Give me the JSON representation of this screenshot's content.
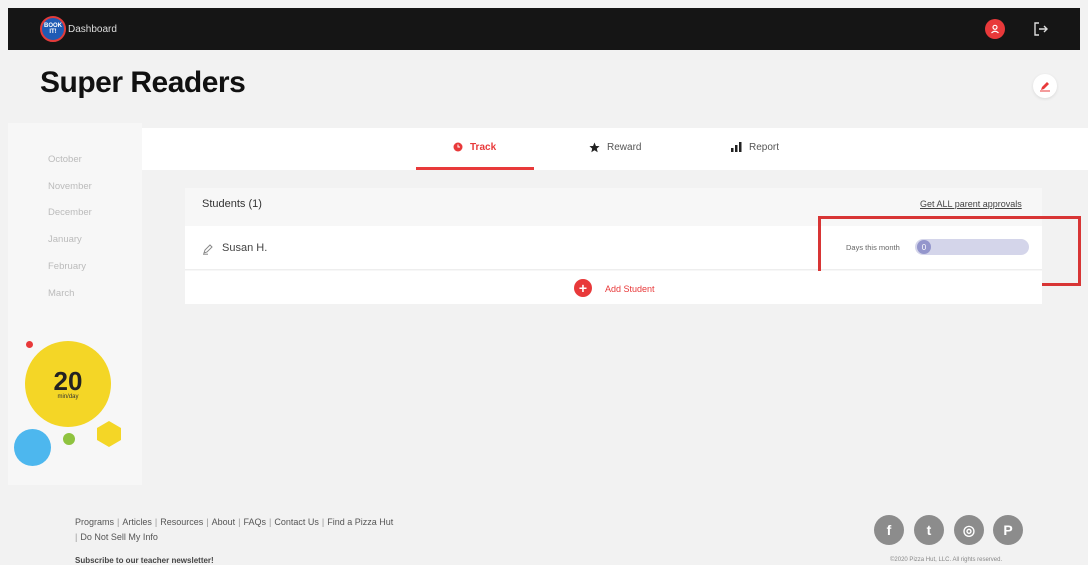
{
  "app": {
    "logo_text": [
      "BOOK",
      "IT!"
    ],
    "nav_label": "Dashboard"
  },
  "page": {
    "title": "Super Readers"
  },
  "sidebar": {
    "months": [
      "October",
      "November",
      "December",
      "January",
      "February",
      "March"
    ]
  },
  "tabs": [
    {
      "label": "Track",
      "icon": "clock-icon",
      "active": true
    },
    {
      "label": "Reward",
      "icon": "star-icon",
      "active": false
    },
    {
      "label": "Report",
      "icon": "bar-chart-icon",
      "active": false
    }
  ],
  "students": {
    "heading": "Students (1)",
    "approvals_link": "Get ALL parent approvals",
    "rows": [
      {
        "name": "Susan H.",
        "days_label": "Days this month",
        "days_value": "0"
      }
    ],
    "add_label": "Add Student",
    "add_symbol": "+"
  },
  "badge": {
    "value": "20",
    "unit": "min/day"
  },
  "footer": {
    "links": [
      "Programs",
      "Articles",
      "Resources",
      "About",
      "FAQs",
      "Contact Us",
      "Find a Pizza Hut",
      "Do Not Sell My Info"
    ],
    "newsletter": "Subscribe to our teacher newsletter!",
    "social": [
      {
        "name": "facebook-icon",
        "glyph": "f"
      },
      {
        "name": "twitter-icon",
        "glyph": "t"
      },
      {
        "name": "instagram-icon",
        "glyph": "◎"
      },
      {
        "name": "pinterest-icon",
        "glyph": "P"
      }
    ],
    "copyright": "©2020 Pizza Hut, LLC. All rights reserved."
  },
  "colors": {
    "accent": "#e8393a",
    "topbar": "#151515",
    "slider_track": "#d4d5ea",
    "slider_knob": "#9496cc",
    "highlight": "#d83535"
  }
}
